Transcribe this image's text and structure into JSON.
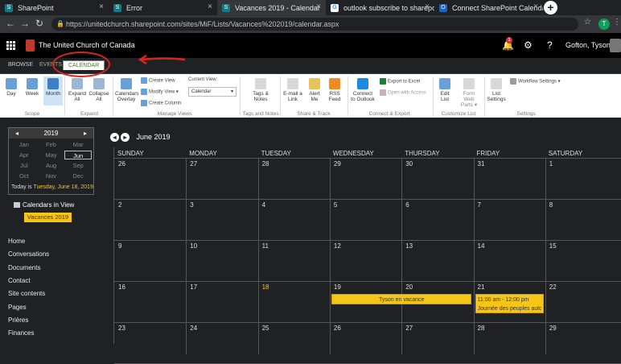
{
  "browser": {
    "tabs": [
      {
        "title": "SharePoint",
        "icon": "sharepoint-icon",
        "active": false
      },
      {
        "title": "Error",
        "icon": "sharepoint-icon",
        "active": false
      },
      {
        "title": "Vacances 2019 - Calendar",
        "icon": "sharepoint-icon",
        "active": true
      },
      {
        "title": "outlook subscribe to sharepoi",
        "icon": "google-icon",
        "active": false
      },
      {
        "title": "Connect SharePoint Calendar",
        "icon": "outlook-icon",
        "active": false
      }
    ],
    "url": "https://unitedchurch.sharepoint.com/sites/MiF/Lists/Vacances%202019/calendar.aspx",
    "profile_initial": "T"
  },
  "suite": {
    "brand": "The United Church of Canada",
    "notification_count": "1",
    "user": "Gofton, Tyson"
  },
  "ribbon_tabs": [
    "BROWSE",
    "EVENTS",
    "CALENDAR"
  ],
  "selected_ribbon_tab": "CALENDAR",
  "ribbon": {
    "day": "Day",
    "week": "Week",
    "month": "Month",
    "expand_all": "Expand All",
    "collapse_all": "Collapse All",
    "calendars_overlay": "Calendars Overlay",
    "create_view": "Create View",
    "modify_view": "Modify View",
    "create_column": "Create Column",
    "current_view_label": "Current View:",
    "current_view_value": "Calendar",
    "tags_notes": "Tags & Notes",
    "email_link": "E-mail a Link",
    "alert_me": "Alert Me",
    "rss_feed": "RSS Feed",
    "connect_outlook": "Connect to Outlook",
    "export_excel": "Export to Excel",
    "open_access": "Open with Access",
    "edit_list": "Edit List",
    "form_web_parts": "Form Web Parts",
    "list_settings": "List Settings",
    "workflow_settings": "Workflow Settings",
    "groups": {
      "scope": "Scope",
      "expand": "Expand",
      "manage_views": "Manage Views",
      "tags_notes": "Tags and Notes",
      "share_track": "Share & Track",
      "connect_export": "Connect & Export",
      "customize_list": "Customize List",
      "settings": "Settings"
    }
  },
  "mini_calendar": {
    "year": "2019",
    "months": [
      "Jan",
      "Feb",
      "Mar",
      "Apr",
      "May",
      "Jun",
      "Jul",
      "Aug",
      "Sep",
      "Oct",
      "Nov",
      "Dec"
    ],
    "selected_month": "Jun",
    "today_label": "Today is",
    "today_value": "Tuesday, June 18, 2019"
  },
  "calendars_in_view": "Calendars in View",
  "calendar_tag": "Vacances 2019",
  "quick_launch": [
    "Home",
    "Conversations",
    "Documents",
    "Contact",
    "Site contents",
    "Pages",
    "Prières",
    "Finances"
  ],
  "calendar": {
    "month_title": "June 2019",
    "weekdays": [
      "SUNDAY",
      "MONDAY",
      "TUESDAY",
      "WEDNESDAY",
      "THURSDAY",
      "FRIDAY",
      "SATURDAY"
    ],
    "weeks": [
      [
        "26",
        "27",
        "28",
        "29",
        "30",
        "31",
        "1"
      ],
      [
        "2",
        "3",
        "4",
        "5",
        "6",
        "7",
        "8"
      ],
      [
        "9",
        "10",
        "11",
        "12",
        "13",
        "14",
        "15"
      ],
      [
        "16",
        "17",
        "18",
        "19",
        "20",
        "21",
        "22"
      ],
      [
        "23",
        "24",
        "25",
        "26",
        "27",
        "28",
        "29"
      ]
    ],
    "today": "18",
    "events": [
      {
        "title": "Tyson en vacance"
      },
      {
        "time": "11:00 am - 12:00 pm",
        "title": "Journée des peuples auto"
      }
    ]
  },
  "colors": {
    "accent": "#f5c518",
    "annotation": "#d9261c",
    "ribbon_tab_green": "#4a7a1f"
  }
}
